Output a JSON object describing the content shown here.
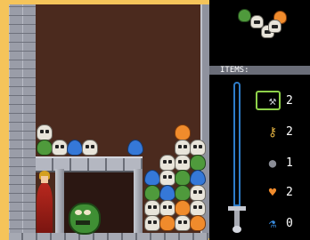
{
  "hud": {
    "items_title": "ITEMS:",
    "items": [
      {
        "name": "shovel",
        "icon": "shovel-icon",
        "glyph": "⚒",
        "color": "#c8ccd4",
        "count": "2",
        "selected": true
      },
      {
        "name": "key",
        "icon": "key-icon",
        "glyph": "⚷",
        "color": "#e0b040",
        "count": "2",
        "selected": false
      },
      {
        "name": "bomb",
        "icon": "bomb-icon",
        "glyph": "●",
        "color": "#8a8d96",
        "count": "1",
        "selected": false
      },
      {
        "name": "heart",
        "icon": "heart-icon",
        "glyph": "♥",
        "color": "#f08b2c",
        "count": "2",
        "selected": false
      },
      {
        "name": "potion",
        "icon": "potion-icon",
        "glyph": "⚗",
        "color": "#3a8de0",
        "count": "0",
        "selected": false
      }
    ]
  },
  "colors": {
    "background": "#f5c45a",
    "well": "#4b2a1e",
    "stone": "#9a9da8",
    "skull": "#e8e4da",
    "green_piece": "#4f9a3c",
    "blue_piece": "#3578d8",
    "orange_piece": "#f08b2c",
    "selection": "#8ed14a"
  }
}
